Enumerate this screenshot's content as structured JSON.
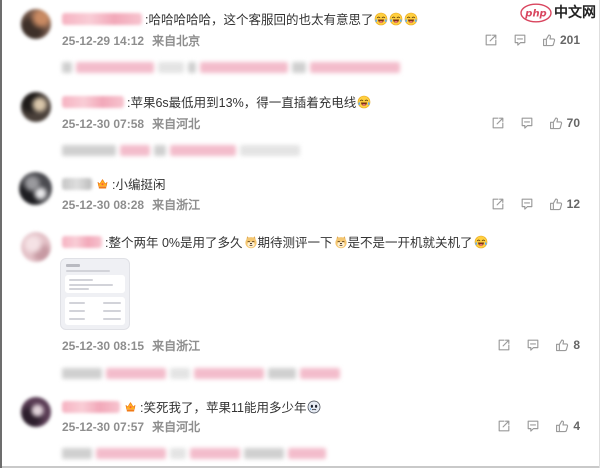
{
  "watermark": {
    "logo": "php",
    "text": "中文网"
  },
  "colors": {
    "background": "#ffffff",
    "comment_text": "#333333",
    "meta_text": "#8e8e8e",
    "count_text": "#666666",
    "action_icon": "#9a9a9a",
    "watermark_logo": "#d9465f"
  },
  "actions": {
    "share_icon": "share-icon",
    "comment_icon": "comment-icon",
    "like_icon": "thumbs-up-icon"
  },
  "comments": [
    {
      "segments": [
        {
          "text": ":哈哈哈哈哈，这个客服回的也太有意思了"
        },
        {
          "icon": "laugh-cry-icon"
        },
        {
          "icon": "laugh-cry-icon"
        },
        {
          "icon": "laugh-cry-icon"
        }
      ],
      "time": "25-12-29 14:12",
      "location": "来自北京",
      "likes": "201"
    },
    {
      "segments": [
        {
          "text": ":苹果6s最低用到13%，得一直插着充电线"
        },
        {
          "icon": "laugh-cry-icon"
        }
      ],
      "time": "25-12-30 07:58",
      "location": "来自河北",
      "likes": "70"
    },
    {
      "badge_icon": "fan-badge-icon",
      "segments": [
        {
          "text": ":小编挺闲"
        }
      ],
      "time": "25-12-30 08:28",
      "location": "来自浙江",
      "likes": "12"
    },
    {
      "segments": [
        {
          "text": ":整个两年 0%是用了多久"
        },
        {
          "icon": "doge-icon"
        },
        {
          "text": "期待测评一下"
        },
        {
          "icon": "doge-icon"
        },
        {
          "text": "是不是一开机就关机了"
        },
        {
          "icon": "laugh-cry-icon"
        }
      ],
      "time": "25-12-30 08:15",
      "location": "来自浙江",
      "likes": "8"
    },
    {
      "badge_icon": "fan-badge-icon",
      "segments": [
        {
          "text": ":笑死我了，苹果11能用多少年"
        },
        {
          "icon": "face-icon"
        }
      ],
      "time": "25-12-30 07:57",
      "location": "来自河北",
      "likes": "4"
    }
  ]
}
